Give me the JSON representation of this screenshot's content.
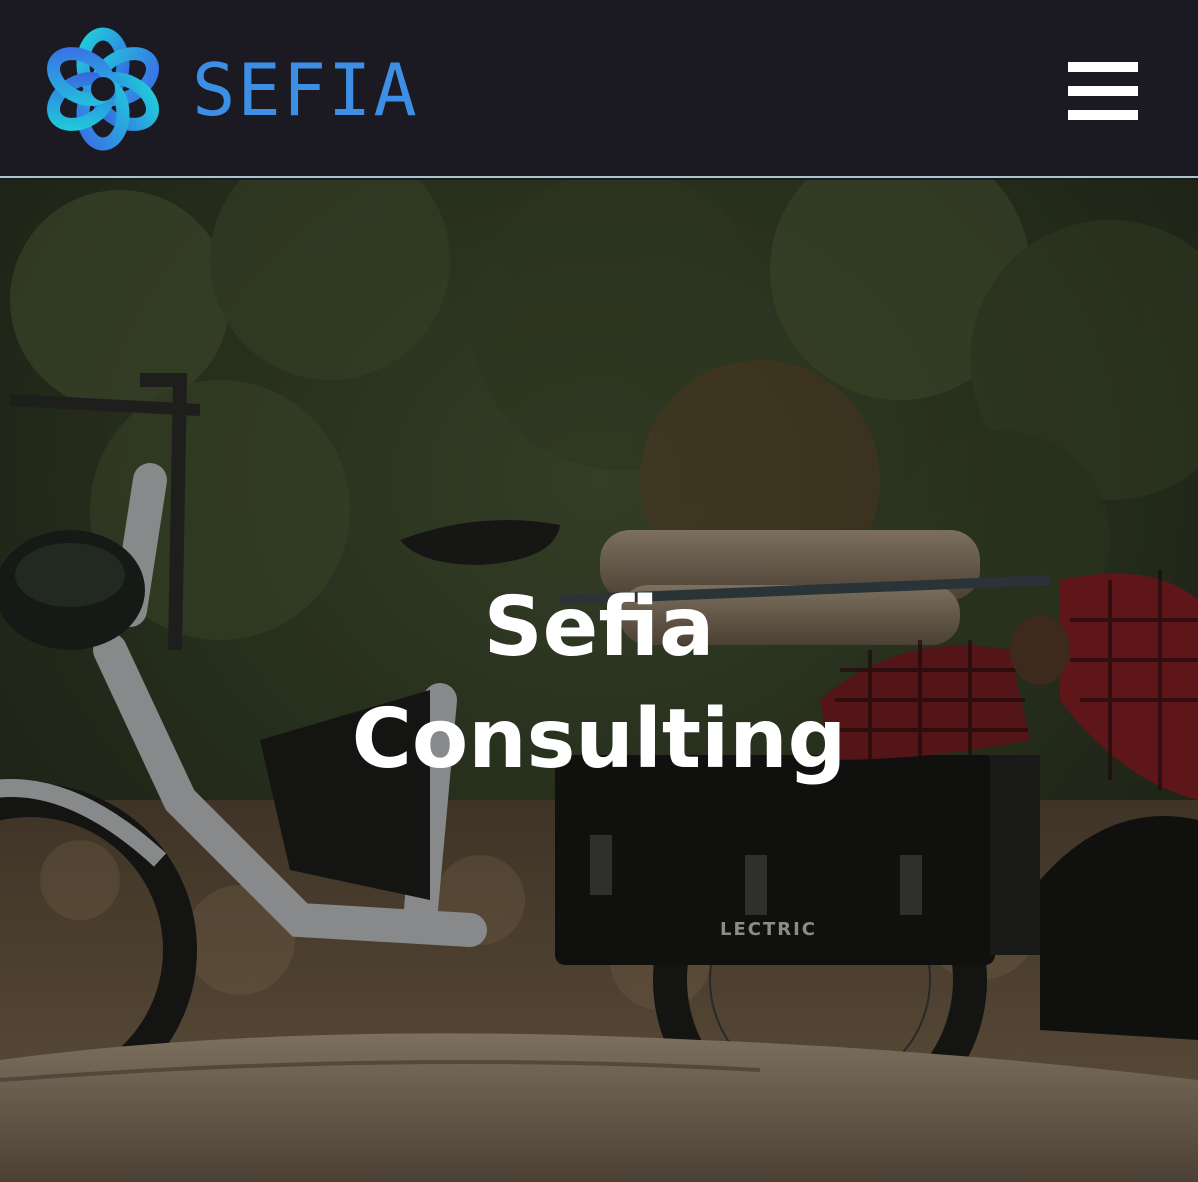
{
  "header": {
    "brand_name": "SEFIA",
    "logo_icon": "sefia-knot-logo",
    "menu_icon": "hamburger-menu-icon"
  },
  "hero": {
    "title_line1": "Sefia",
    "title_line2": "Consulting",
    "photo_brand_text": "LECTRIC"
  },
  "colors": {
    "header_bg": "#1b1a22",
    "brand_blue": "#3d8fe6",
    "menu_white": "#ffffff",
    "header_rule": "#a9c6cc"
  }
}
